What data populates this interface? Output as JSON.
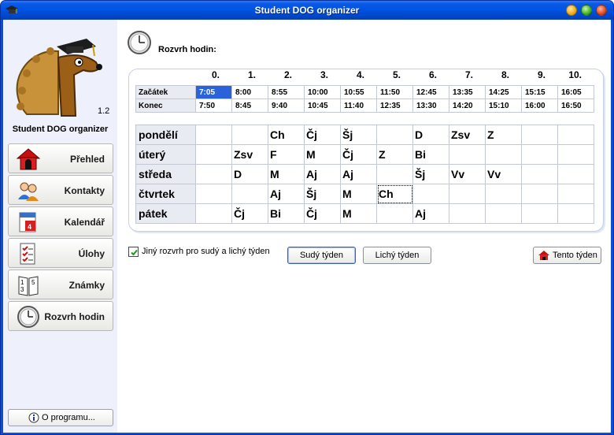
{
  "window": {
    "title": "Student DOG organizer"
  },
  "sidebar": {
    "version": "1.2",
    "app_name": "Student DOG organizer",
    "items": [
      {
        "label": "Přehled",
        "icon": "doghouse-icon"
      },
      {
        "label": "Kontakty",
        "icon": "contacts-icon"
      },
      {
        "label": "Kalendář",
        "icon": "calendar-icon"
      },
      {
        "label": "Úlohy",
        "icon": "tasks-icon"
      },
      {
        "label": "Známky",
        "icon": "grades-icon"
      },
      {
        "label": "Rozvrh hodin",
        "icon": "clock-icon"
      }
    ],
    "about_label": "O programu..."
  },
  "main": {
    "section_title": "Rozvrh hodin:",
    "columns": [
      "0.",
      "1.",
      "2.",
      "3.",
      "4.",
      "5.",
      "6.",
      "7.",
      "8.",
      "9.",
      "10."
    ],
    "times": {
      "start_label": "Začátek",
      "end_label": "Konec",
      "start": [
        "7:05",
        "8:00",
        "8:55",
        "10:00",
        "10:55",
        "11:50",
        "12:45",
        "13:35",
        "14:25",
        "15:15",
        "16:05"
      ],
      "end": [
        "7:50",
        "8:45",
        "9:40",
        "10:45",
        "11:40",
        "12:35",
        "13:30",
        "14:20",
        "15:10",
        "16:00",
        "16:50"
      ],
      "selected_index": 0
    },
    "days": [
      {
        "name": "pondělí",
        "lessons": [
          "",
          "",
          "Ch",
          "Čj",
          "Šj",
          "",
          "D",
          "Zsv",
          "Z",
          "",
          ""
        ]
      },
      {
        "name": "úterý",
        "lessons": [
          "",
          "Zsv",
          "F",
          "M",
          "Čj",
          "Z",
          "Bi",
          "",
          "",
          "",
          ""
        ]
      },
      {
        "name": "středa",
        "lessons": [
          "",
          "D",
          "M",
          "Aj",
          "Aj",
          "",
          "Šj",
          "Vv",
          "Vv",
          "",
          ""
        ]
      },
      {
        "name": "čtvrtek",
        "lessons": [
          "",
          "",
          "Aj",
          "Šj",
          "M",
          "Ch",
          "",
          "",
          "",
          "",
          ""
        ]
      },
      {
        "name": "pátek",
        "lessons": [
          "",
          "Čj",
          "Bi",
          "Čj",
          "M",
          "",
          "Aj",
          "",
          "",
          "",
          ""
        ]
      }
    ],
    "alt_week_checkbox": {
      "label": "Jiný  rozvrh pro sudý a lichý týden",
      "checked": true
    },
    "buttons": {
      "even_week": "Sudý týden",
      "odd_week": "Lichý týden",
      "this_week": "Tento týden"
    }
  }
}
